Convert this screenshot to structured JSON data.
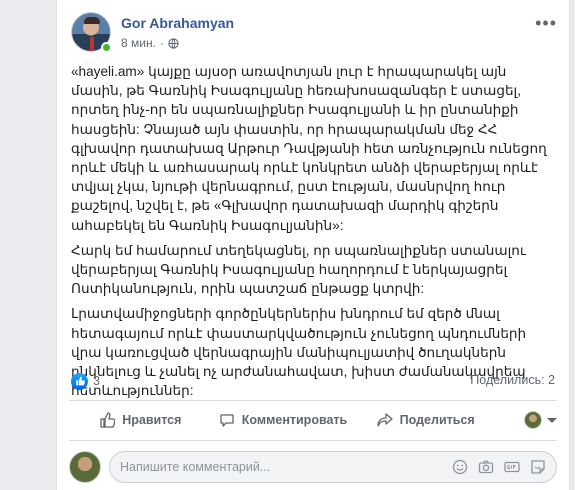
{
  "post": {
    "author": "Gor Abrahamyan",
    "time": "8 мин.",
    "paragraphs": [
      "«hayeli.am» կայքը այսօր առավոտյան լուր է հրապարակել այն մասին, թե Գառնիկ Իսագուլյանը հեռախոսազանգեր է ստացել, որտեղ ինչ-որ են սպառնալիքներ Իսագուլյանի և իր ընտանիքի հասցեին: Չնայած այն փաստին, որ հրապարակման մեջ ՀՀ գլխավոր դատախազ Արթուր Դավթյանի հետ առնչություն ունեցող որևէ մեկի և առհասարակ որևէ կոնկրետ անձի վերաբերյալ որևէ տվյալ չկա, նյութի վերնագրում, ըստ էության, մասնրվող հուր քաշելով, նշվել է, թե «Գլխավոր դատախազի մարդիկ գիշերն ահաբեկել են Գառնիկ Իսագուլյանին»:",
      "Հարկ եմ համարում տեղեկացնել, որ սպառնալիքներ ստանալու վերաբերյալ Գառնիկ Իսագուլյանը հաղորդում է ներկայացրել Ոստիկանություն, որին պատշաճ ընթացք կտրվի:",
      "Լրատվամիջոցների գործընկերներիս խնդրում եմ զերծ մնալ հետագայում որևէ փաստարկվածություն չունեցող պնդումների վրա կառուցված վերնագրային մանիպուլյատիվ ծուղակներն ընկնելուց և չանել ոչ արժանահավատ, խիստ ժամանակավրեպ հետևություններ:"
    ],
    "likes": "3",
    "shares": "Поделились: 2"
  },
  "actions": {
    "like": "Нравится",
    "comment": "Комментировать",
    "share": "Поделиться"
  },
  "comment_input": {
    "placeholder": "Напишите комментарий..."
  },
  "icons": [
    "more-icon",
    "globe-icon",
    "like-icon",
    "comment-icon",
    "share-icon",
    "emoji-icon",
    "camera-icon",
    "gif-icon",
    "sticker-icon"
  ],
  "colors": {
    "name_link": "#385898",
    "like_blue": "#0165e1",
    "online": "#42b72a"
  }
}
